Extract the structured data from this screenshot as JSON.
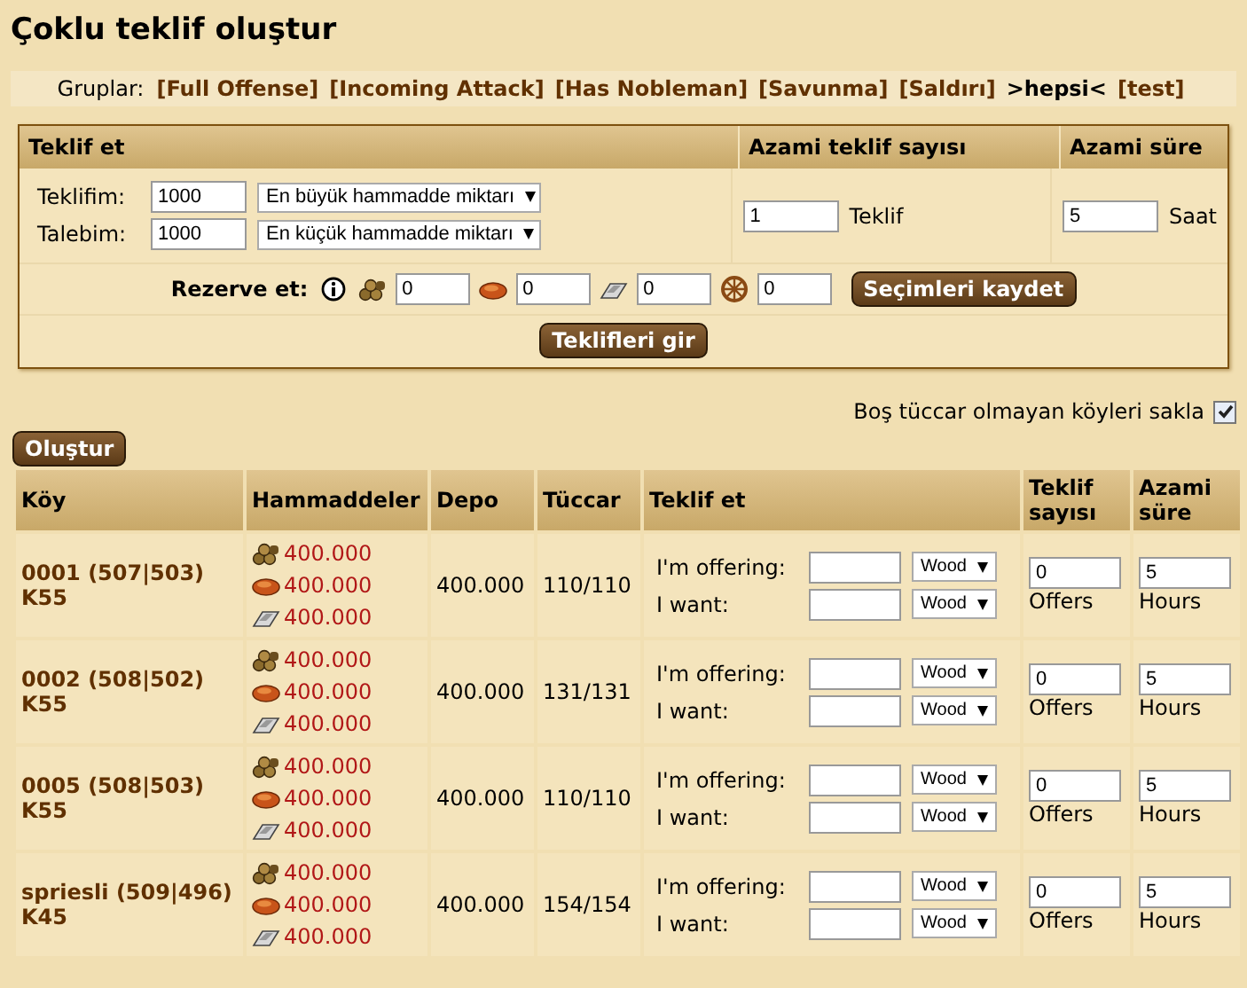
{
  "title": "Çoklu teklif oluştur",
  "groups": {
    "label": "Gruplar:",
    "items": [
      {
        "label": "[Full Offense]",
        "selected": false
      },
      {
        "label": "[Incoming Attack]",
        "selected": false
      },
      {
        "label": "[Has Nobleman]",
        "selected": false
      },
      {
        "label": "[Savunma]",
        "selected": false
      },
      {
        "label": "[Saldırı]",
        "selected": false
      },
      {
        "label": ">hepsi<",
        "selected": true
      },
      {
        "label": "[test]",
        "selected": false
      }
    ]
  },
  "offer_panel": {
    "headers": [
      "Teklif et",
      "Azami teklif sayısı",
      "Azami süre"
    ],
    "rows": [
      {
        "label": "Teklifim:",
        "value": "1000",
        "select": "En büyük hammadde miktarı"
      },
      {
        "label": "Talebim:",
        "value": "1000",
        "select": "En küçük hammadde miktarı"
      }
    ],
    "max_offers": {
      "value": "1",
      "unit": "Teklif"
    },
    "max_time": {
      "value": "5",
      "unit": "Saat"
    },
    "reserve": {
      "label": "Rezerve et:",
      "fields": [
        {
          "kind": "wood",
          "value": "0"
        },
        {
          "kind": "clay",
          "value": "0"
        },
        {
          "kind": "iron",
          "value": "0"
        },
        {
          "kind": "wheel",
          "value": "0"
        }
      ]
    },
    "save_button": "Seçimleri kaydet",
    "submit_button": "Teklifleri gir"
  },
  "hide_option": {
    "label": "Boş tüccar olmayan köyleri sakla",
    "checked": true
  },
  "create_button": "Oluştur",
  "table": {
    "columns": [
      "Köy",
      "Hammaddeler",
      "Depo",
      "Tüccar",
      "Teklif et",
      "Teklif sayısı",
      "Azami süre"
    ],
    "rows": [
      {
        "village": "0001 (507|503)",
        "continent": "K55",
        "resources": [
          {
            "kind": "wood",
            "amount": "400.000"
          },
          {
            "kind": "clay",
            "amount": "400.000"
          },
          {
            "kind": "iron",
            "amount": "400.000"
          }
        ],
        "storage": "400.000",
        "merchants": "110/110",
        "offer_label": "I'm offering:",
        "offer_select": "Wood",
        "want_label": "I want:",
        "want_select": "Wood",
        "offers_value": "0",
        "offers_unit": "Offers",
        "hours_value": "5",
        "hours_unit": "Hours"
      },
      {
        "village": "0002 (508|502)",
        "continent": "K55",
        "resources": [
          {
            "kind": "wood",
            "amount": "400.000"
          },
          {
            "kind": "clay",
            "amount": "400.000"
          },
          {
            "kind": "iron",
            "amount": "400.000"
          }
        ],
        "storage": "400.000",
        "merchants": "131/131",
        "offer_label": "I'm offering:",
        "offer_select": "Wood",
        "want_label": "I want:",
        "want_select": "Wood",
        "offers_value": "0",
        "offers_unit": "Offers",
        "hours_value": "5",
        "hours_unit": "Hours"
      },
      {
        "village": "0005 (508|503)",
        "continent": "K55",
        "resources": [
          {
            "kind": "wood",
            "amount": "400.000"
          },
          {
            "kind": "clay",
            "amount": "400.000"
          },
          {
            "kind": "iron",
            "amount": "400.000"
          }
        ],
        "storage": "400.000",
        "merchants": "110/110",
        "offer_label": "I'm offering:",
        "offer_select": "Wood",
        "want_label": "I want:",
        "want_select": "Wood",
        "offers_value": "0",
        "offers_unit": "Offers",
        "hours_value": "5",
        "hours_unit": "Hours"
      },
      {
        "village": "spriesli (509|496)",
        "continent": "K45",
        "resources": [
          {
            "kind": "wood",
            "amount": "400.000"
          },
          {
            "kind": "clay",
            "amount": "400.000"
          },
          {
            "kind": "iron",
            "amount": "400.000"
          }
        ],
        "storage": "400.000",
        "merchants": "154/154",
        "offer_label": "I'm offering:",
        "offer_select": "Wood",
        "want_label": "I want:",
        "want_select": "Wood",
        "offers_value": "0",
        "offers_unit": "Offers",
        "hours_value": "5",
        "hours_unit": "Hours"
      }
    ]
  }
}
